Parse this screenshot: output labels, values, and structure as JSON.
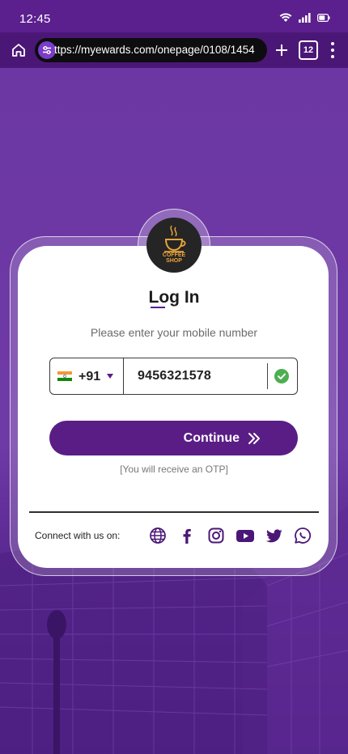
{
  "status": {
    "time": "12:45"
  },
  "browser": {
    "url": "ttps://myewards.com/onepage/0108/1454",
    "tab_count": "12"
  },
  "card": {
    "title": "Log In",
    "subtitle": "Please enter your mobile number",
    "logo_text_1": "COFFEE",
    "logo_text_2": "SHOP",
    "country_code": "+91",
    "phone_value": "9456321578",
    "continue_label": "Continue",
    "otp_note": "[You will receive an OTP]",
    "connect_label": "Connect with us on:"
  },
  "colors": {
    "brand": "#5a1d86",
    "success": "#4caf50"
  }
}
